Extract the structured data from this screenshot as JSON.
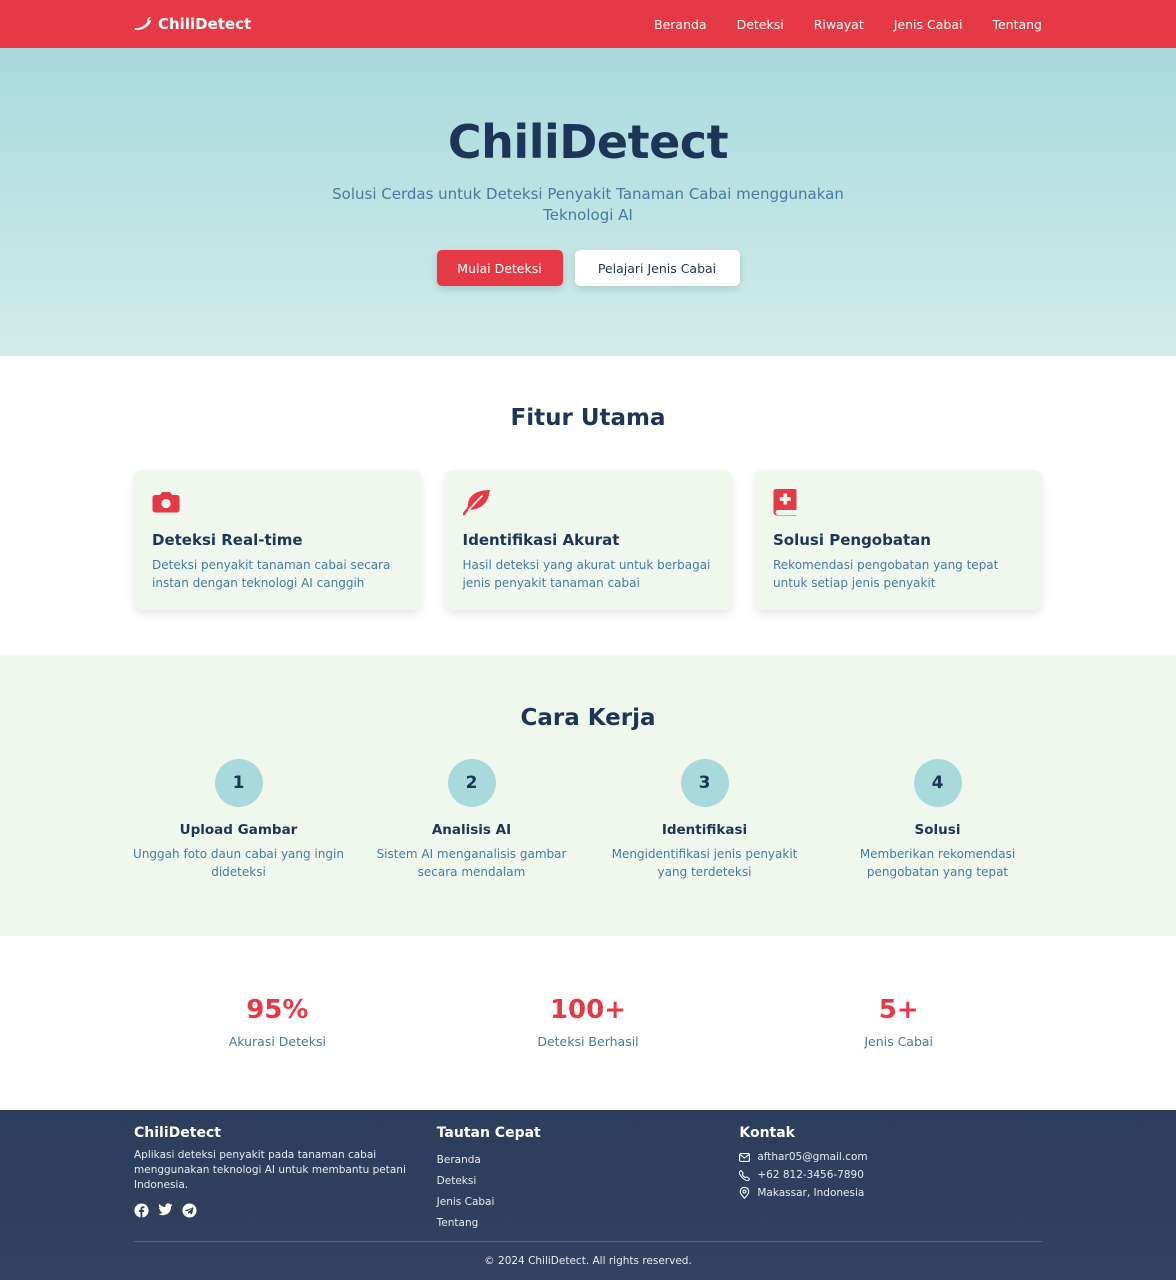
{
  "colors": {
    "primary": "#e63946",
    "navy": "#1d3557",
    "teal": "#a8dadc",
    "muted": "#457b9d",
    "mint": "#f0f8ee",
    "footer": "#2f3c5c"
  },
  "navbar": {
    "brand": "ChiliDetect",
    "brand_icon": "chili-icon",
    "links": [
      "Beranda",
      "Deteksi",
      "Riwayat",
      "Jenis Cabai",
      "Tentang"
    ]
  },
  "hero": {
    "title": "ChiliDetect",
    "subtitle": "Solusi Cerdas untuk Deteksi Penyakit Tanaman Cabai menggunakan Teknologi AI",
    "primary_button": "Mulai Deteksi",
    "secondary_button": "Pelajari Jenis Cabai"
  },
  "features": {
    "title": "Fitur Utama",
    "items": [
      {
        "icon": "camera-icon",
        "title": "Deteksi Real-time",
        "description": "Deteksi penyakit tanaman cabai secara instan dengan teknologi AI canggih"
      },
      {
        "icon": "leaf-icon",
        "title": "Identifikasi Akurat",
        "description": "Hasil deteksi yang akurat untuk berbagai jenis penyakit tanaman cabai"
      },
      {
        "icon": "medical-book-icon",
        "title": "Solusi Pengobatan",
        "description": "Rekomendasi pengobatan yang tepat untuk setiap jenis penyakit"
      }
    ]
  },
  "how": {
    "title": "Cara Kerja",
    "steps": [
      {
        "number": "1",
        "title": "Upload Gambar",
        "description": "Unggah foto daun cabai yang ingin dideteksi"
      },
      {
        "number": "2",
        "title": "Analisis AI",
        "description": "Sistem AI menganalisis gambar secara mendalam"
      },
      {
        "number": "3",
        "title": "Identifikasi",
        "description": "Mengidentifikasi jenis penyakit yang terdeteksi"
      },
      {
        "number": "4",
        "title": "Solusi",
        "description": "Memberikan rekomendasi pengobatan yang tepat"
      }
    ]
  },
  "stats": [
    {
      "value": "95%",
      "label": "Akurasi Deteksi"
    },
    {
      "value": "100+",
      "label": "Deteksi Berhasil"
    },
    {
      "value": "5+",
      "label": "Jenis Cabai"
    }
  ],
  "footer": {
    "about": {
      "title": "ChiliDetect",
      "text": "Aplikasi deteksi penyakit pada tanaman cabai menggunakan teknologi AI untuk membantu petani Indonesia.",
      "social_icons": [
        "facebook-icon",
        "twitter-icon",
        "telegram-icon"
      ]
    },
    "links": {
      "title": "Tautan Cepat",
      "items": [
        "Beranda",
        "Deteksi",
        "Jenis Cabai",
        "Tentang"
      ]
    },
    "contact": {
      "title": "Kontak",
      "email": "afthar05@gmail.com",
      "phone": "+62 812-3456-7890",
      "address": "Makassar, Indonesia"
    },
    "copyright": "© 2024 ChiliDetect. All rights reserved."
  }
}
